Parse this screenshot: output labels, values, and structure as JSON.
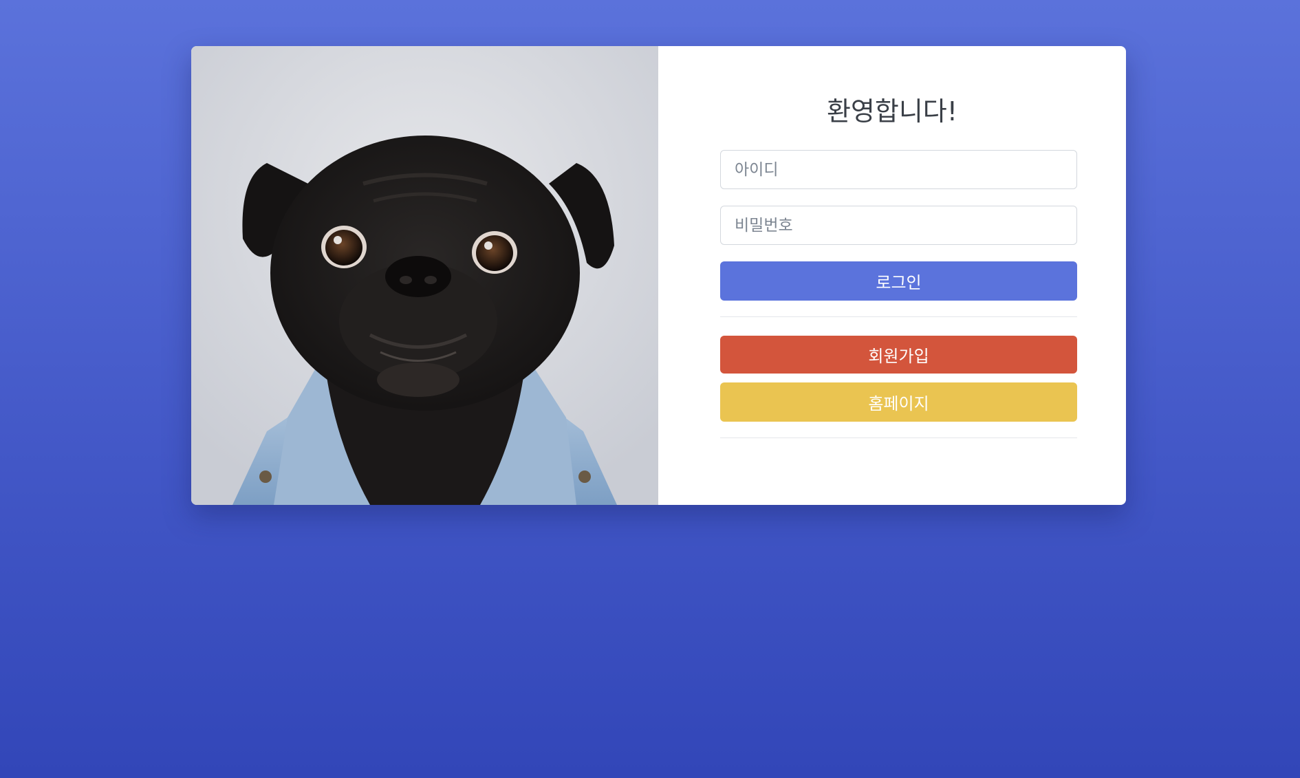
{
  "login_card": {
    "photo": {
      "icon": "pug-in-denim-jacket-photo"
    },
    "title": "환영합니다!",
    "username": {
      "placeholder": "아이디",
      "value": ""
    },
    "password": {
      "placeholder": "비밀번호",
      "value": ""
    },
    "login_button": "로그인",
    "signup_button": "회원가입",
    "homepage_button": "홈페이지"
  },
  "colors": {
    "background_top": "#5b72db",
    "background_bottom": "#3246b8",
    "login_button": "#5b73dc",
    "signup_button": "#d3553c",
    "homepage_button": "#eac451"
  }
}
